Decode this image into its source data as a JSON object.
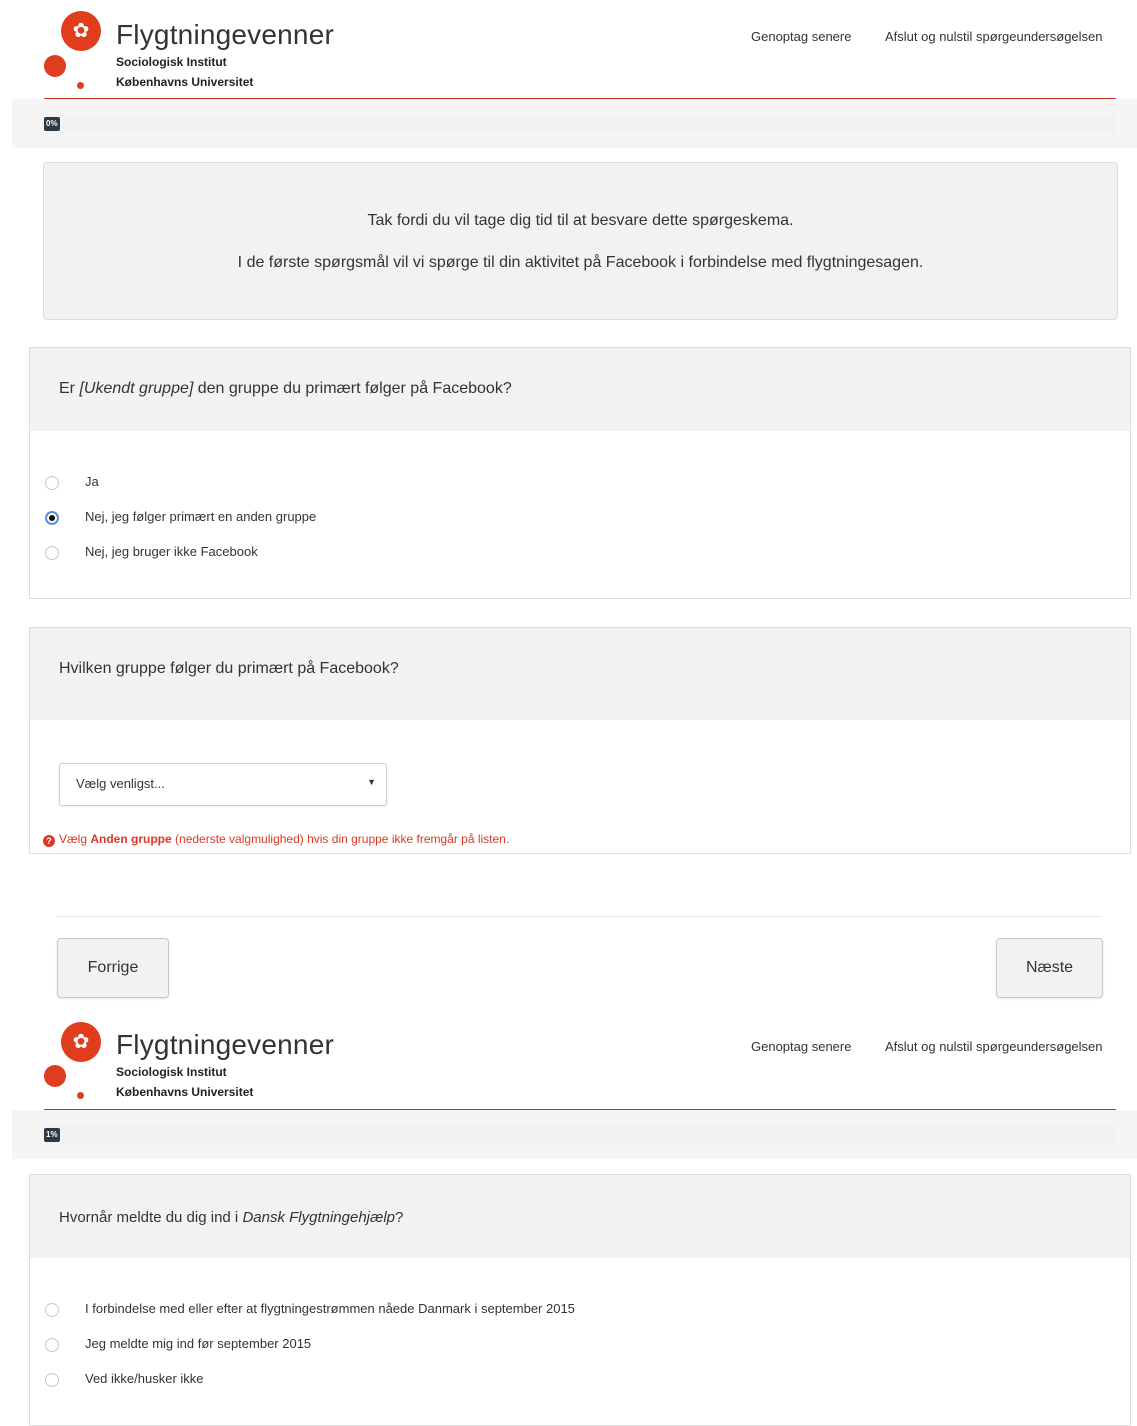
{
  "page1": {
    "header": {
      "brand_title": "Flygtningevenner",
      "brand_sub1": "Sociologisk Institut",
      "brand_sub2": "Københavns Universitet",
      "link_resume": "Genoptag senere",
      "link_quit": "Afslut og nulstil spørgeundersøgelsen"
    },
    "progress": {
      "label": "0%",
      "value": 0
    },
    "welcome": {
      "line1": "Tak fordi du vil tage dig tid til at besvare dette spørgeskema.",
      "line2": "I de første spørgsmål vil vi spørge til din aktivitet på Facebook i forbindelse med flygtningesagen."
    },
    "q1": {
      "title_pre": "Er ",
      "title_italic": "[Ukendt gruppe]",
      "title_post": " den gruppe du primært følger på Facebook?",
      "options": [
        "Ja",
        "Nej, jeg følger primært en anden gruppe",
        "Nej, jeg bruger ikke Facebook"
      ],
      "selected_index": 1
    },
    "q2": {
      "title": "Hvilken gruppe følger du primært på Facebook?",
      "select_value": "Vælg venligst...",
      "hint_pre": "Vælg ",
      "hint_bold": "Anden gruppe",
      "hint_post": " (nederste valgmulighed) hvis din gruppe ikke fremgår på listen."
    },
    "nav": {
      "prev": "Forrige",
      "next": "Næste"
    }
  },
  "page2": {
    "header": {
      "brand_title": "Flygtningevenner",
      "brand_sub1": "Sociologisk Institut",
      "brand_sub2": "Københavns Universitet",
      "link_resume": "Genoptag senere",
      "link_quit": "Afslut og nulstil spørgeundersøgelsen"
    },
    "progress": {
      "label": "1%",
      "value": 1
    },
    "q1": {
      "title_pre": "Hvornår meldte du dig ind i ",
      "title_italic": "Dansk Flygtningehjælp",
      "title_post": "?",
      "options": [
        "I forbindelse med eller efter at flygtningestrømmen nåede Danmark i september 2015",
        "Jeg meldte mig ind før september 2015",
        "Ved ikke/husker ikke"
      ]
    }
  },
  "colors": {
    "accent_red": "#e03c1e",
    "progress_badge": "#2b3a46",
    "hint_red": "#d93a26"
  }
}
